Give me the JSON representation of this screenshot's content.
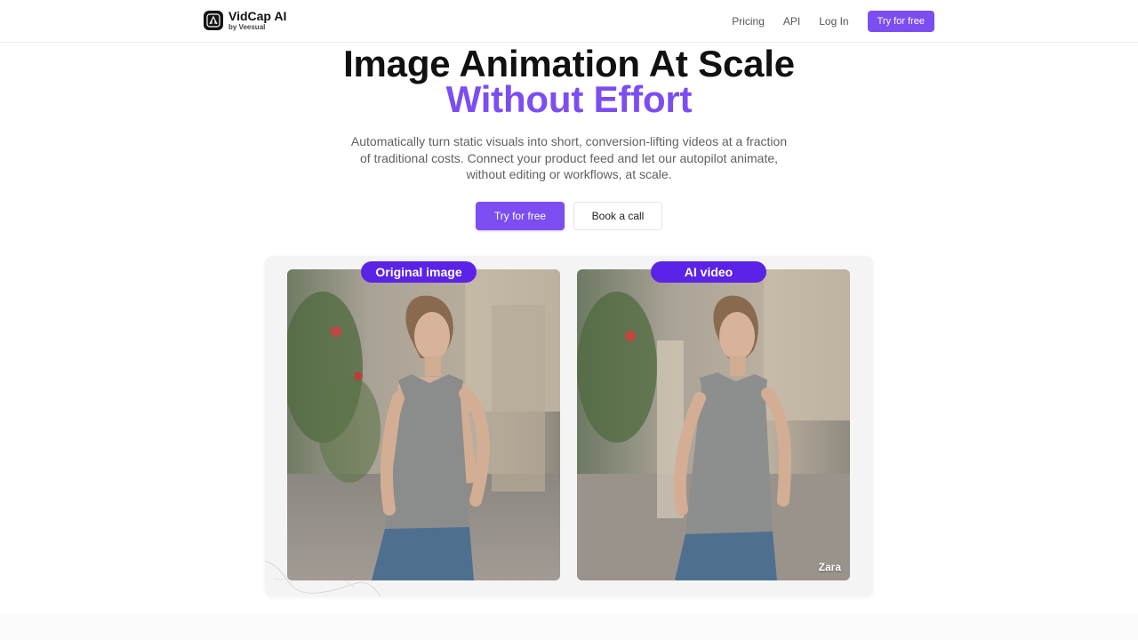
{
  "nav": {
    "brand_name": "VidCap AI",
    "brand_sub": "by Veesual",
    "links": [
      "Pricing",
      "API",
      "Log In"
    ],
    "cta": "Try for free"
  },
  "hero": {
    "title_line1": "Image Animation At Scale",
    "title_line2": "Without Effort",
    "subtitle": "Automatically turn static visuals into short, conversion-lifting videos at a fraction of traditional costs. Connect your product feed and let our autopilot animate, without editing or workflows, at scale.",
    "primary_button": "Try for free",
    "secondary_button": "Book a call"
  },
  "demo": {
    "left_label": "Original image",
    "right_label": "AI video",
    "watermark": "Zara"
  },
  "colors": {
    "accent": "#7c4df1",
    "pill": "#5b23e8",
    "heading": "#111111",
    "body_text": "#5f5f66"
  },
  "icons": {
    "logo": "vidcap-logo-icon"
  }
}
